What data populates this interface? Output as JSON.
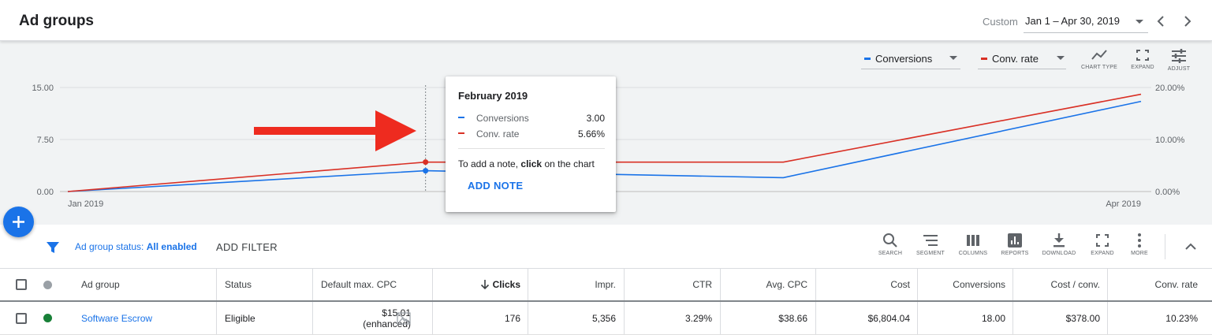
{
  "header": {
    "title": "Ad groups",
    "date_range_label": "Custom",
    "date_range_value": "Jan 1 – Apr 30, 2019"
  },
  "chart": {
    "metric_selectors": [
      {
        "label": "Conversions",
        "color": "#1a73e8"
      },
      {
        "label": "Conv. rate",
        "color": "#d93025"
      }
    ],
    "tools": [
      "CHART TYPE",
      "EXPAND",
      "ADJUST"
    ],
    "tooltip": {
      "title": "February 2019",
      "rows": [
        {
          "label": "Conversions",
          "value": "3.00",
          "color": "#1a73e8"
        },
        {
          "label": "Conv. rate",
          "value": "5.66%",
          "color": "#d93025"
        }
      ],
      "note_prefix": "To add a note, ",
      "note_bold": "click",
      "note_suffix": " on the chart",
      "add_note": "ADD NOTE"
    }
  },
  "chart_data": {
    "type": "line",
    "x": [
      "Jan 2019",
      "Feb 2019",
      "Mar 2019",
      "Apr 2019"
    ],
    "x_tick_labels": [
      "Jan 2019",
      "Apr 2019"
    ],
    "series": [
      {
        "name": "Conversions",
        "axis": "left",
        "color": "#1a73e8",
        "values": [
          0,
          3,
          2,
          13
        ]
      },
      {
        "name": "Conv. rate",
        "axis": "right",
        "color": "#d93025",
        "values": [
          0,
          5.66,
          5.66,
          18.7
        ]
      }
    ],
    "left_ticks": [
      "0.00",
      "7.50",
      "15.00"
    ],
    "left_ylim": [
      0,
      15
    ],
    "right_ticks": [
      "0.00%",
      "10.00%",
      "20.00%"
    ],
    "right_ylim": [
      0,
      20
    ],
    "grid": true
  },
  "filter_bar": {
    "filter_prefix": "Ad group status: ",
    "filter_value": "All enabled",
    "add_filter": "ADD FILTER",
    "tools": [
      {
        "label": "SEARCH",
        "icon": "search-icon"
      },
      {
        "label": "SEGMENT",
        "icon": "segment-icon"
      },
      {
        "label": "COLUMNS",
        "icon": "columns-icon"
      },
      {
        "label": "REPORTS",
        "icon": "reports-icon"
      },
      {
        "label": "DOWNLOAD",
        "icon": "download-icon"
      },
      {
        "label": "EXPAND",
        "icon": "expand-icon"
      },
      {
        "label": "MORE",
        "icon": "more-icon"
      }
    ]
  },
  "table": {
    "columns": [
      "Ad group",
      "Status",
      "Default max. CPC",
      "Clicks",
      "Impr.",
      "CTR",
      "Avg. CPC",
      "Cost",
      "Conversions",
      "Cost / conv.",
      "Conv. rate"
    ],
    "rows": [
      {
        "ad_group": "Software Escrow",
        "status": "Eligible",
        "status_color": "#188038",
        "cpc_value": "$15.01",
        "cpc_note": "(enhanced)",
        "clicks": "176",
        "impr": "5,356",
        "ctr": "3.29%",
        "avg_cpc": "$38.66",
        "cost": "$6,804.04",
        "conversions": "18.00",
        "cost_per_conv": "$378.00",
        "conv_rate": "10.23%"
      }
    ]
  }
}
